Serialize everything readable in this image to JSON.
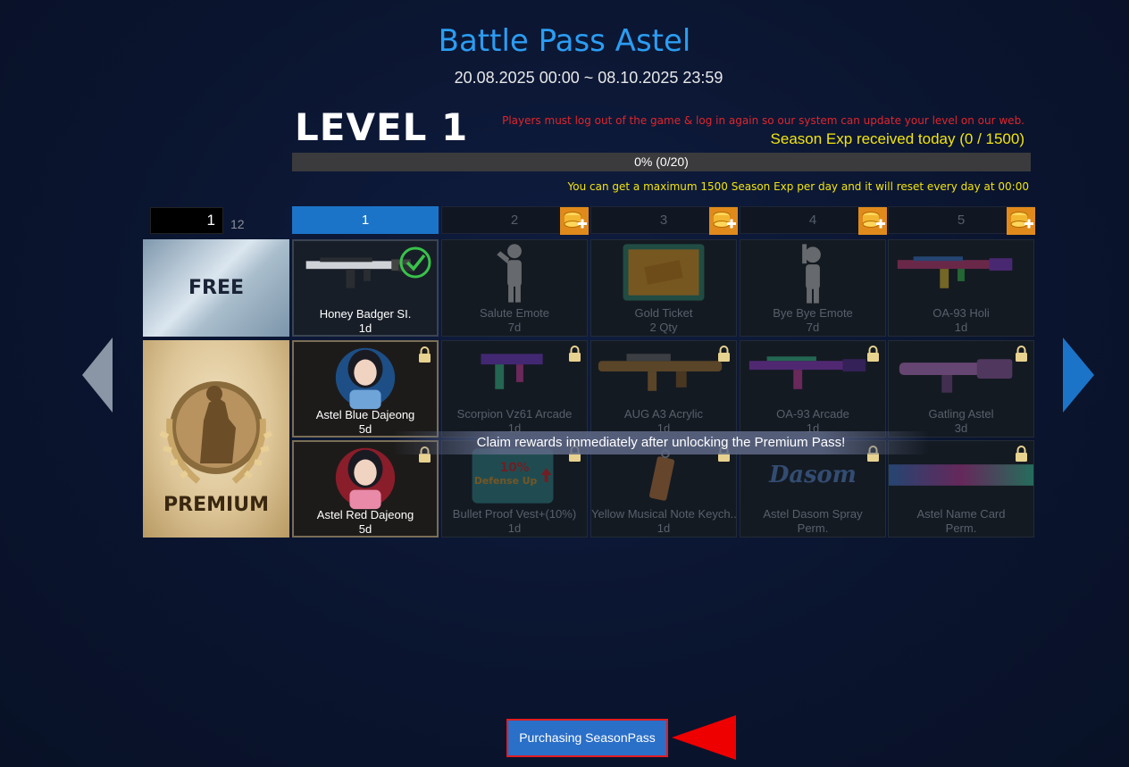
{
  "header": {
    "title": "Battle Pass Astel",
    "dates": "20.08.2025 00:00 ~ 08.10.2025 23:59"
  },
  "level": {
    "label": "LEVEL 1",
    "warning": "Players must log out of the game & log in again so our system can update your level on our web.",
    "season_exp_today": "Season Exp received today (0 / 1500)",
    "progress_text": "0% (0/20)",
    "progress_fraction": 0.0,
    "max_note": "You can get a maximum 1500 Season Exp per day and it will reset every day at 00:00"
  },
  "pagination": {
    "current": "1",
    "total": "12"
  },
  "level_tabs": [
    {
      "label": "1",
      "active": true,
      "coin_icon": false
    },
    {
      "label": "2",
      "active": false,
      "coin_icon": true
    },
    {
      "label": "3",
      "active": false,
      "coin_icon": true
    },
    {
      "label": "4",
      "active": false,
      "coin_icon": true
    },
    {
      "label": "5",
      "active": false,
      "coin_icon": true
    }
  ],
  "rows": {
    "free_label": "FREE",
    "premium_label": "PREMIUM"
  },
  "free_rewards": [
    {
      "name": "Honey Badger SI.",
      "duration": "1d",
      "claimed": true,
      "icon": "rifle-icon"
    },
    {
      "name": "Salute Emote",
      "duration": "7d",
      "icon": "salute-emote-icon"
    },
    {
      "name": "Gold Ticket",
      "duration": "2 Qty",
      "icon": "gold-ticket-icon"
    },
    {
      "name": "Bye Bye Emote",
      "duration": "7d",
      "icon": "bye-emote-icon"
    },
    {
      "name": "OA-93 Holi",
      "duration": "1d",
      "icon": "rifle-icon"
    }
  ],
  "premium_rewards_row1": [
    {
      "name": "Astel Blue Dajeong",
      "duration": "5d",
      "icon": "character-icon"
    },
    {
      "name": "Scorpion Vz61 Arcade",
      "duration": "1d",
      "icon": "smg-icon"
    },
    {
      "name": "AUG A3 Acrylic",
      "duration": "1d",
      "icon": "rifle-icon"
    },
    {
      "name": "OA-93 Arcade",
      "duration": "1d",
      "icon": "rifle-icon"
    },
    {
      "name": "Gatling Astel",
      "duration": "3d",
      "icon": "gatling-icon"
    }
  ],
  "premium_rewards_row2": [
    {
      "name": "Astel Red Dajeong",
      "duration": "5d",
      "icon": "character-icon"
    },
    {
      "name": "Bullet Proof Vest+(10%)",
      "duration": "1d",
      "icon": "vest-icon",
      "badge_pct": "10%",
      "badge_text": "Defense Up"
    },
    {
      "name": "Yellow Musical Note Keych...",
      "duration": "1d",
      "icon": "keychain-icon"
    },
    {
      "name": "Astel Dasom Spray",
      "duration": "Perm.",
      "icon": "spray-icon",
      "spray_text": "Dasom"
    },
    {
      "name": "Astel Name Card",
      "duration": "Perm.",
      "icon": "name-card-icon"
    }
  ],
  "banner": "Claim rewards immediately after unlocking the Premium Pass!",
  "buy_button": "Purchasing SeasonPass",
  "colors": {
    "accent": "#1c74c9",
    "title": "#2b9df2",
    "warning": "#e0252d",
    "exp": "#f2e40e"
  }
}
